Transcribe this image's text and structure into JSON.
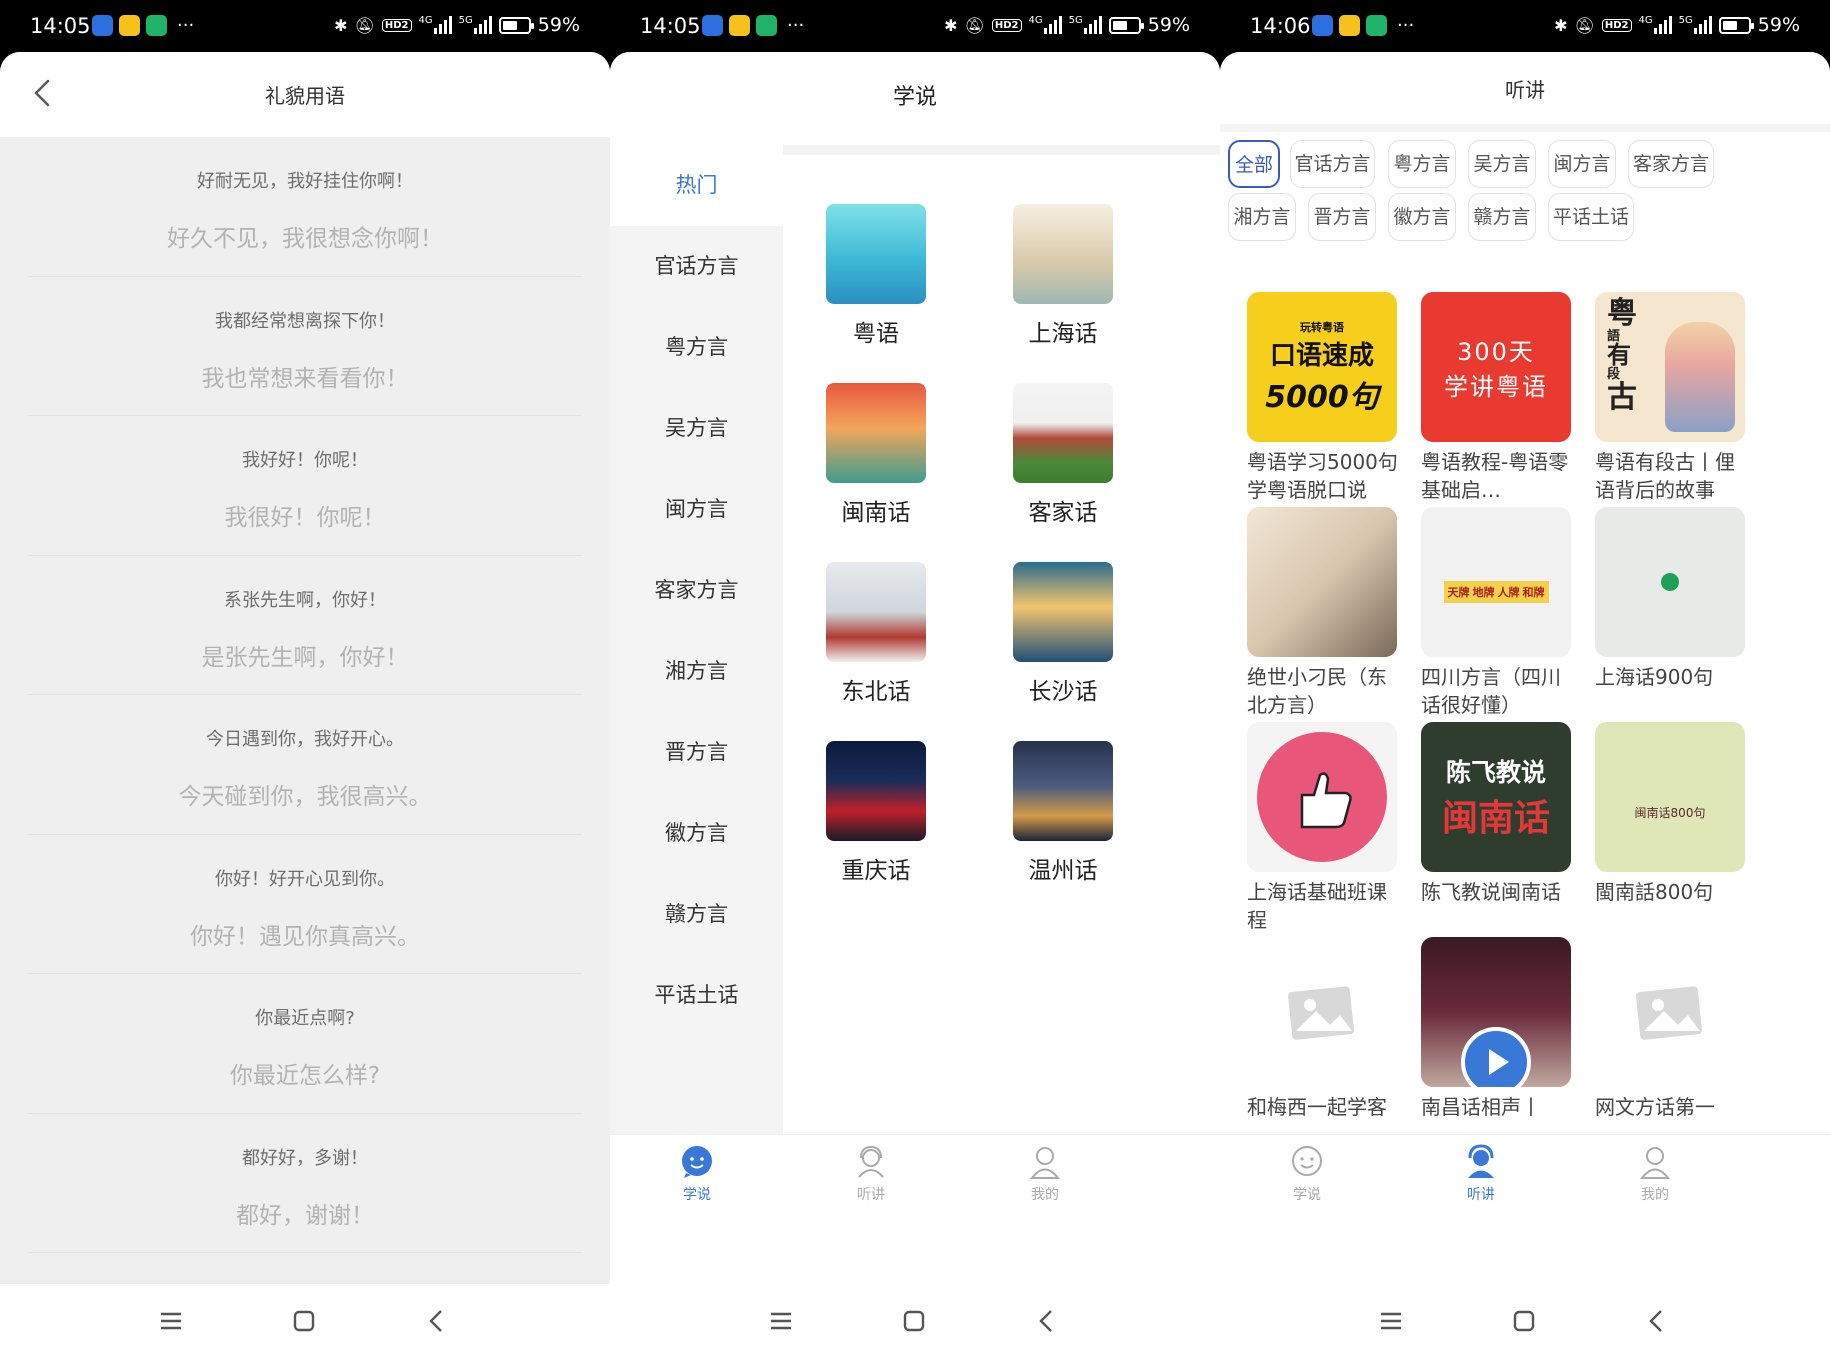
{
  "screens": [
    {
      "status": {
        "time": "14:05",
        "battery": "59%",
        "battery_level": 0.59,
        "net_left": "4G",
        "net_right": "5G",
        "hd": "HD2"
      },
      "header": {
        "title": "礼貌用语"
      },
      "phrases": [
        {
          "source": "好耐无见，我好挂住你啊！",
          "translation": "好久不见，我很想念你啊！"
        },
        {
          "source": "我都经常想离探下你！",
          "translation": "我也常想来看看你！"
        },
        {
          "source": "我好好！你呢！",
          "translation": "我很好！你呢！"
        },
        {
          "source": "系张先生啊，你好！",
          "translation": "是张先生啊，你好！"
        },
        {
          "source": "今日遇到你，我好开心。",
          "translation": "今天碰到你，我很高兴。"
        },
        {
          "source": "你好！好开心见到你。",
          "translation": "你好！遇见你真高兴。"
        },
        {
          "source": "你最近点啊?",
          "translation": "你最近怎么样?"
        },
        {
          "source": "都好好，多谢！",
          "translation": "都好，谢谢！"
        }
      ]
    },
    {
      "status": {
        "time": "14:05",
        "battery": "59%",
        "battery_level": 0.59,
        "net_left": "4G",
        "net_right": "5G",
        "hd": "HD2"
      },
      "header": {
        "title": "学说"
      },
      "sidebar": [
        "热门",
        "官话方言",
        "粤方言",
        "吴方言",
        "闽方言",
        "客家方言",
        "湘方言",
        "晋方言",
        "徽方言",
        "赣方言",
        "平话土话"
      ],
      "grid": [
        "粤语",
        "上海话",
        "闽南话",
        "客家话",
        "东北话",
        "长沙话",
        "重庆话",
        "温州话"
      ],
      "tabs": [
        "学说",
        "听讲",
        "我的"
      ]
    },
    {
      "status": {
        "time": "14:06",
        "battery": "59%",
        "battery_level": 0.59,
        "net_left": "4G",
        "net_right": "5G",
        "hd": "HD2"
      },
      "header": {
        "title": "听讲"
      },
      "chips": [
        "全部",
        "官话方言",
        "粤方言",
        "吴方言",
        "闽方言",
        "客家方言",
        "湘方言",
        "晋方言",
        "徽方言",
        "赣方言",
        "平话土话"
      ],
      "cards": [
        {
          "title": "粤语学习5000句学粤语脱口说",
          "thumb_text": [
            "玩转粤语",
            "口语速成",
            "5000句"
          ]
        },
        {
          "title": "粤语教程-粤语零基础启…",
          "thumb_text": [
            "300天",
            "学讲粤语"
          ]
        },
        {
          "title": "粤语有段古丨俚语背后的故事",
          "thumb_text": [
            "粤",
            "語",
            "有",
            "段",
            "古"
          ]
        },
        {
          "title": "绝世小刁民（东北方言）",
          "thumb_text": []
        },
        {
          "title": "四川方言（四川话很好懂）",
          "thumb_text": [
            "天牌",
            "地牌",
            "人牌",
            "和牌"
          ]
        },
        {
          "title": "上海话900句",
          "thumb_text": []
        },
        {
          "title": "上海话基础班课程",
          "thumb_text": []
        },
        {
          "title": "陈飞教说闽南话",
          "thumb_text": [
            "陈飞教说",
            "闽南话"
          ]
        },
        {
          "title": "閩南話800句",
          "thumb_text": [
            "闽南话800句"
          ]
        },
        {
          "title": "和梅西一起学客",
          "thumb_text": []
        },
        {
          "title": "南昌话相声丨",
          "thumb_text": []
        },
        {
          "title": "网文方话第一",
          "thumb_text": []
        }
      ],
      "tabs": [
        "学说",
        "听讲",
        "我的"
      ]
    }
  ],
  "colors": {
    "accent": "#3a78d8",
    "chip_active": "#3a5bb8",
    "list_bg": "#efefef"
  }
}
